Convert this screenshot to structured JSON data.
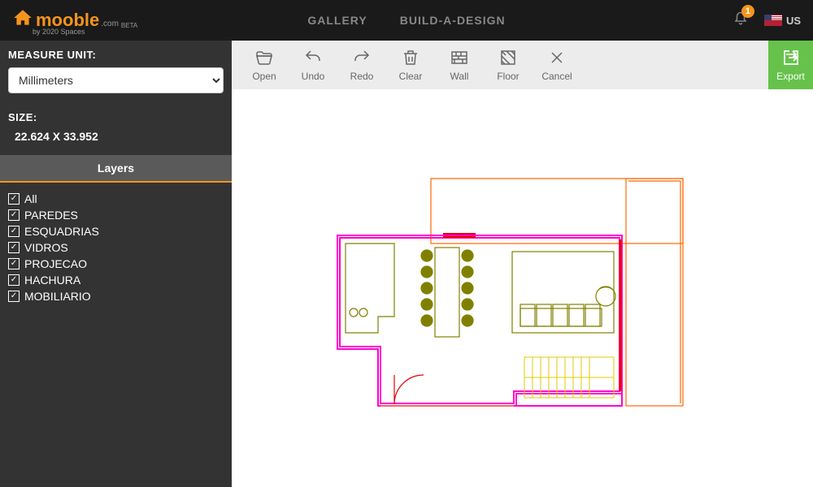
{
  "header": {
    "logo_main": "mooble",
    "logo_suffix": ".com",
    "logo_beta": "BETA",
    "logo_sub": "by 2020 Spaces",
    "nav": {
      "gallery": "GALLERY",
      "build": "BUILD-A-DESIGN"
    },
    "bell_count": "1",
    "locale": "US"
  },
  "sidebar": {
    "measure_label": "MEASURE UNIT:",
    "measure_value": "Millimeters",
    "size_label": "SIZE:",
    "size_value": "22.624 X 33.952",
    "layers_header": "Layers",
    "layers": [
      {
        "label": "All",
        "checked": true
      },
      {
        "label": "PAREDES",
        "checked": true
      },
      {
        "label": "ESQUADRIAS",
        "checked": true
      },
      {
        "label": "VIDROS",
        "checked": true
      },
      {
        "label": "PROJECAO",
        "checked": true
      },
      {
        "label": "HACHURA",
        "checked": true
      },
      {
        "label": "MOBILIARIO",
        "checked": true
      }
    ]
  },
  "toolbar": {
    "open": "Open",
    "undo": "Undo",
    "redo": "Redo",
    "clear": "Clear",
    "wall": "Wall",
    "floor": "Floor",
    "cancel": "Cancel",
    "export": "Export"
  }
}
